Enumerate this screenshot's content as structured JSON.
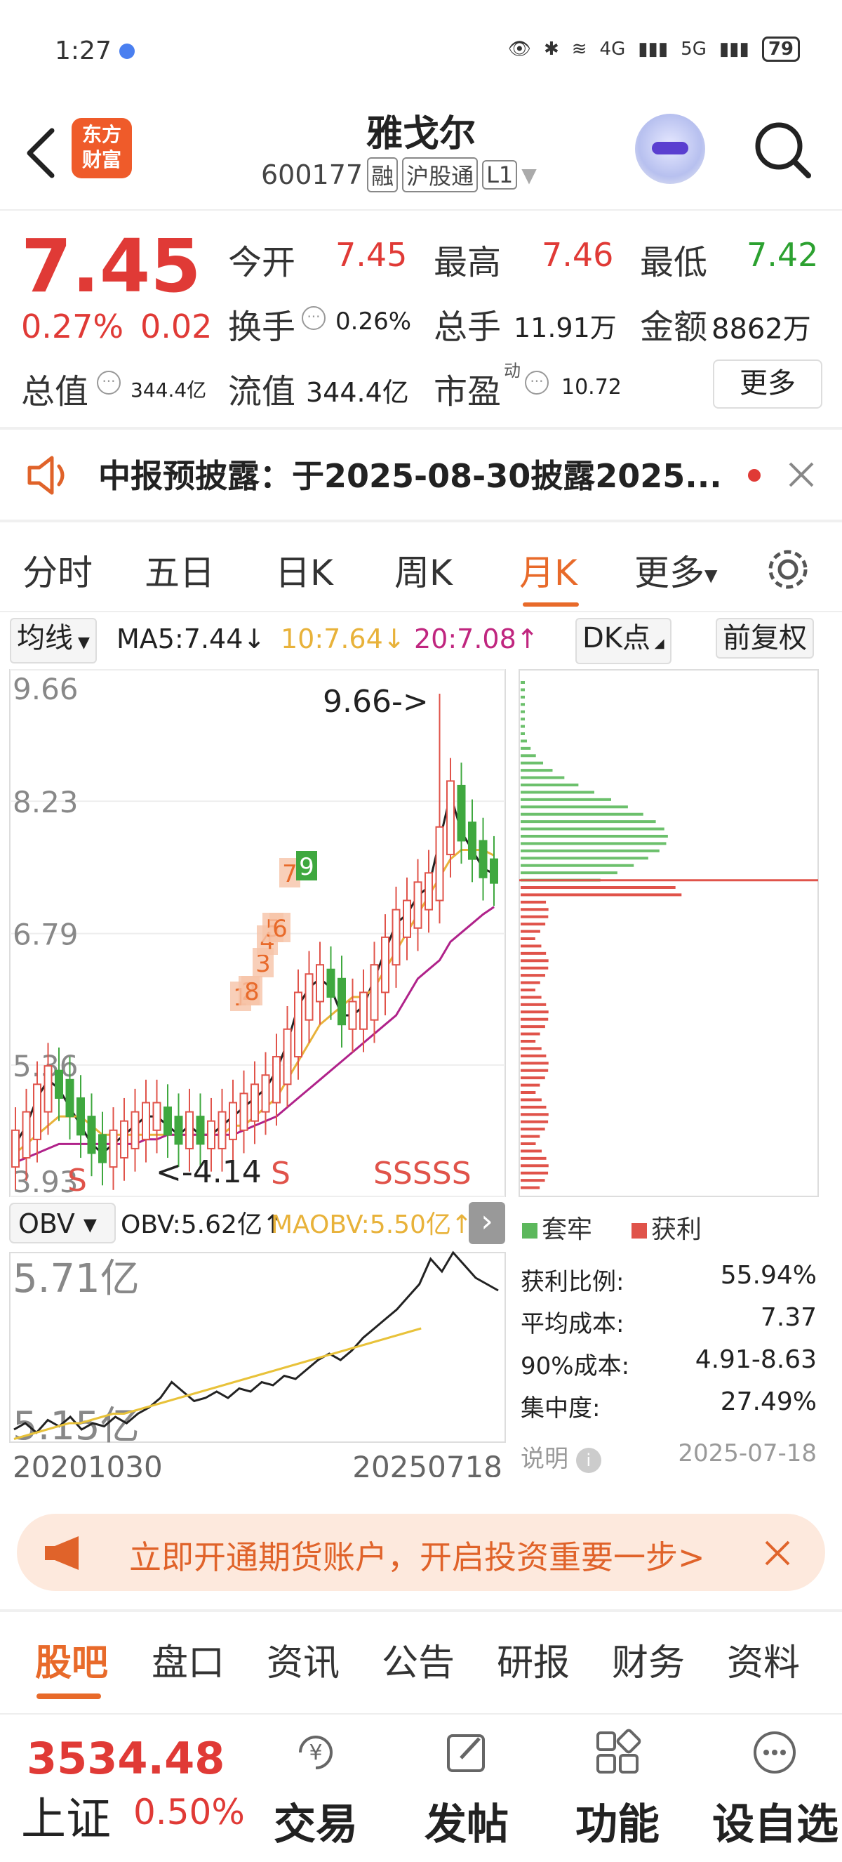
{
  "status_bar": {
    "time": "1:27",
    "network": "4G",
    "network2": "5G",
    "battery": "79"
  },
  "header": {
    "stock_name": "雅戈尔",
    "stock_code": "600177",
    "tags": [
      "融",
      "沪股通",
      "L1"
    ],
    "logo_line1": "东方",
    "logo_line2": "财富"
  },
  "quote": {
    "price": "7.45",
    "change_pct": "0.27%",
    "change_abs": "0.02",
    "open_label": "今开",
    "open": "7.45",
    "high_label": "最高",
    "high": "7.46",
    "low_label": "最低",
    "low": "7.42",
    "turnover_label": "换手",
    "turnover": "0.26%",
    "volume_label": "总手",
    "volume": "11.91万",
    "amount_label": "金额",
    "amount": "8862万",
    "mktcap_label": "总值",
    "mktcap": "344.4亿",
    "float_label": "流值",
    "float": "344.4亿",
    "pe_label": "市盈",
    "pe_sup": "动",
    "pe": "10.72",
    "more_button": "更多",
    "colors": {
      "up": "#e03a36",
      "down": "#2ca130"
    }
  },
  "notice": {
    "text": "中报预披露：于2025-08-30披露2025..."
  },
  "chart_tabs": {
    "items": [
      "分时",
      "五日",
      "日K",
      "周K",
      "月K",
      "更多"
    ],
    "active": "月K"
  },
  "indicator_row": {
    "ma_select": "均线",
    "ma5": "MA5:7.44↓",
    "ma10": "10:7.64↓",
    "ma20": "20:7.08↑",
    "dk_button": "DK点",
    "adjust_button": "前复权"
  },
  "chart_data": [
    {
      "type": "candlestick",
      "title": "",
      "ylim": [
        3.93,
        9.66
      ],
      "y_ticks": [
        "9.66",
        "8.23",
        "6.79",
        "5.36",
        "3.93"
      ],
      "annotations": [
        "9.66->",
        "<-4.14"
      ],
      "signals": [
        "S",
        "S",
        "S",
        "SSSSS"
      ],
      "numbered_marks": [
        "1",
        "2",
        "3",
        "4",
        "5",
        "6",
        "7",
        "8",
        "9"
      ],
      "x_start": "20201030",
      "x_end": "20250718",
      "series": [
        {
          "name": "MA5",
          "values": [
            4.5,
            4.7,
            5.0,
            5.2,
            5.1,
            4.9,
            4.7,
            4.5,
            4.4,
            4.5,
            4.6,
            4.7,
            4.8,
            4.8,
            4.7,
            4.6,
            4.7,
            4.6,
            4.6,
            4.7,
            4.8,
            4.9,
            5.0,
            5.1,
            5.3,
            5.6,
            6.0,
            6.2,
            6.3,
            6.2,
            5.9,
            5.9,
            6.0,
            6.3,
            6.6,
            6.9,
            7.0,
            7.2,
            7.3,
            7.8,
            8.3,
            7.9,
            7.7,
            7.5,
            7.44
          ]
        },
        {
          "name": "MA10",
          "values": [
            4.4,
            4.5,
            4.6,
            4.7,
            4.8,
            4.8,
            4.8,
            4.7,
            4.6,
            4.6,
            4.6,
            4.6,
            4.6,
            4.6,
            4.6,
            4.6,
            4.6,
            4.6,
            4.6,
            4.6,
            4.7,
            4.7,
            4.8,
            4.9,
            5.0,
            5.2,
            5.4,
            5.6,
            5.8,
            5.9,
            6.0,
            6.1,
            6.1,
            6.2,
            6.4,
            6.6,
            6.8,
            7.0,
            7.2,
            7.4,
            7.6,
            7.7,
            7.7,
            7.7,
            7.64
          ]
        },
        {
          "name": "MA20",
          "values": [
            4.3,
            4.35,
            4.4,
            4.45,
            4.5,
            4.5,
            4.5,
            4.5,
            4.5,
            4.5,
            4.5,
            4.5,
            4.55,
            4.55,
            4.6,
            4.6,
            4.6,
            4.6,
            4.6,
            4.6,
            4.6,
            4.65,
            4.7,
            4.75,
            4.8,
            4.9,
            5.0,
            5.1,
            5.2,
            5.3,
            5.4,
            5.5,
            5.6,
            5.7,
            5.8,
            5.9,
            6.1,
            6.3,
            6.4,
            6.5,
            6.7,
            6.8,
            6.9,
            7.0,
            7.08
          ]
        }
      ]
    },
    {
      "type": "line",
      "indicator": "OBV",
      "obv_label": "OBV:5.62亿↑",
      "maobv_label": "MAOBV:5.50亿↑",
      "y_ticks": [
        "5.71亿",
        "5.15亿"
      ],
      "series": [
        {
          "name": "OBV",
          "values": [
            5.18,
            5.2,
            5.17,
            5.21,
            5.19,
            5.22,
            5.18,
            5.2,
            5.19,
            5.22,
            5.2,
            5.23,
            5.25,
            5.28,
            5.33,
            5.3,
            5.27,
            5.28,
            5.3,
            5.28,
            5.31,
            5.3,
            5.33,
            5.32,
            5.35,
            5.34,
            5.37,
            5.4,
            5.42,
            5.4,
            5.43,
            5.47,
            5.5,
            5.53,
            5.56,
            5.6,
            5.64,
            5.72,
            5.68,
            5.74,
            5.7,
            5.66,
            5.64,
            5.62
          ]
        },
        {
          "name": "MAOBV",
          "values": [
            5.15,
            5.16,
            5.17,
            5.18,
            5.19,
            5.2,
            5.2,
            5.21,
            5.22,
            5.23,
            5.23,
            5.24,
            5.25,
            5.26,
            5.27,
            5.28,
            5.29,
            5.3,
            5.31,
            5.32,
            5.33,
            5.34,
            5.35,
            5.36,
            5.37,
            5.38,
            5.39,
            5.4,
            5.41,
            5.42,
            5.43,
            5.44,
            5.45,
            5.46,
            5.47,
            5.48,
            5.49,
            5.5
          ]
        }
      ]
    }
  ],
  "chip_panel": {
    "legend_trapped": "套牢",
    "legend_profit": "获利",
    "profit_ratio_label": "获利比例:",
    "profit_ratio": "55.94%",
    "avg_cost_label": "平均成本:",
    "avg_cost": "7.37",
    "cost90_label": "90%成本:",
    "cost90": "4.91-8.63",
    "concentration_label": "集中度:",
    "concentration": "27.49%",
    "explain_label": "说明",
    "date": "2025-07-18"
  },
  "banner": {
    "text": "立即开通期货账户，开启投资重要一步>"
  },
  "bottom_tabs": {
    "items": [
      "股吧",
      "盘口",
      "资讯",
      "公告",
      "研报",
      "财务",
      "资料"
    ],
    "active": "股吧"
  },
  "footer": {
    "index_value": "3534.48",
    "index_name": "上证",
    "index_pct": "0.50%",
    "buttons": [
      "交易",
      "发帖",
      "功能",
      "设自选"
    ]
  }
}
